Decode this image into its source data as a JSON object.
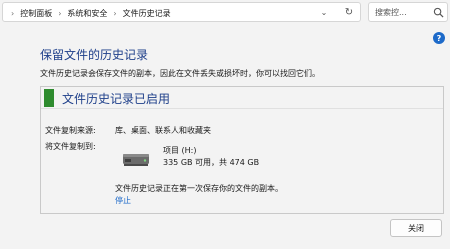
{
  "breadcrumb": [
    "控制面板",
    "系统和安全",
    "文件历史记录"
  ],
  "search": {
    "placeholder": "搜索控..."
  },
  "help_label": "?",
  "page": {
    "title": "保留文件的历史记录",
    "description": "文件历史记录会保存文件的副本，因此在文件丢失或损坏时，你可以找回它们。"
  },
  "status": {
    "title": "文件历史记录已启用",
    "color": "#2e8b2e"
  },
  "details": {
    "source_label": "文件复制来源:",
    "source_value": "库、桌面、联系人和收藏夹",
    "target_label": "将文件复制到:",
    "drive_name": "项目 (H:)",
    "drive_space": "335 GB 可用，共 474 GB",
    "drive_icon": "hard-drive-icon"
  },
  "note": "文件历史记录正在第一次保存你的文件的副本。",
  "stop_link": "停止",
  "close_button": "关闭"
}
